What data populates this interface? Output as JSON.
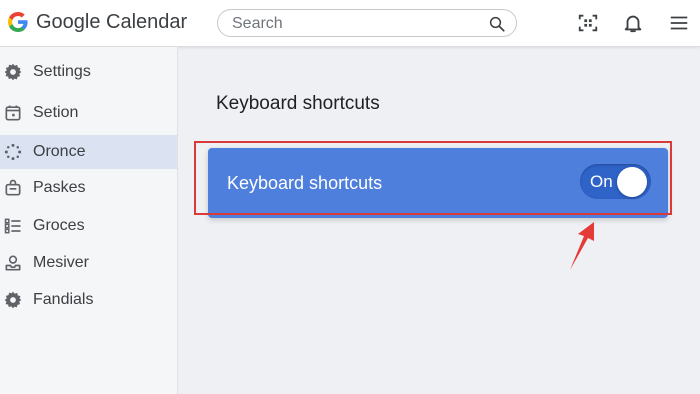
{
  "app": {
    "logo_icon": "google-g-icon",
    "title": "Google Calendar"
  },
  "search": {
    "placeholder": "Search",
    "value": "",
    "icon": "search-icon"
  },
  "header_icons": [
    "scan-icon",
    "bell-icon",
    "menu-icon"
  ],
  "sidebar": {
    "items": [
      {
        "label": "Settings",
        "icon": "gear-icon",
        "active": false
      },
      {
        "label": "Setion",
        "icon": "calendar-icon",
        "active": false
      },
      {
        "label": "Oronce",
        "icon": "dots-circle-icon",
        "active": true
      },
      {
        "label": "Paskes",
        "icon": "bag-icon",
        "active": false
      },
      {
        "label": "Groces",
        "icon": "list-icon",
        "active": false
      },
      {
        "label": "Mesiver",
        "icon": "inbox-icon",
        "active": false
      },
      {
        "label": "Fandials",
        "icon": "gear-icon",
        "active": false
      }
    ]
  },
  "main": {
    "section_title": "Keyboard shortcuts",
    "setting": {
      "label": "Keyboard shortcuts",
      "toggle_state": "On",
      "enabled": true
    }
  },
  "colors": {
    "accent": "#4f7fdc",
    "toggle": "#2f63c8",
    "highlight": "#d93a3a",
    "active_nav": "#dbe3f3"
  }
}
